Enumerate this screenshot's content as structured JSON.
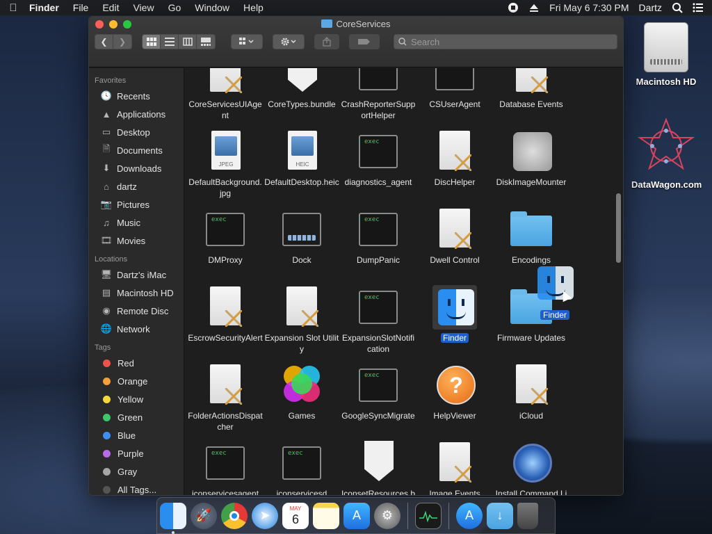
{
  "menubar": {
    "app_name": "Finder",
    "menus": [
      "File",
      "Edit",
      "View",
      "Go",
      "Window",
      "Help"
    ],
    "clock": "Fri May 6  7:30 PM",
    "user": "Dartz"
  },
  "desktop": {
    "items": [
      {
        "label": "Macintosh HD",
        "icon": "hard-drive-icon"
      },
      {
        "label": "DataWagon.com",
        "icon": "datawagon-icon"
      }
    ]
  },
  "window": {
    "title": "CoreServices",
    "search_placeholder": "Search"
  },
  "sidebar": {
    "favorites_header": "Favorites",
    "favorites": [
      {
        "label": "Recents",
        "icon": "recents-icon"
      },
      {
        "label": "Applications",
        "icon": "applications-icon"
      },
      {
        "label": "Desktop",
        "icon": "desktop-icon"
      },
      {
        "label": "Documents",
        "icon": "documents-icon"
      },
      {
        "label": "Downloads",
        "icon": "downloads-icon"
      },
      {
        "label": "dartz",
        "icon": "home-icon"
      },
      {
        "label": "Pictures",
        "icon": "pictures-icon"
      },
      {
        "label": "Music",
        "icon": "music-icon"
      },
      {
        "label": "Movies",
        "icon": "movies-icon"
      }
    ],
    "locations_header": "Locations",
    "locations": [
      {
        "label": "Dartz's iMac",
        "icon": "imac-icon"
      },
      {
        "label": "Macintosh HD",
        "icon": "hard-drive-icon"
      },
      {
        "label": "Remote Disc",
        "icon": "disc-icon"
      },
      {
        "label": "Network",
        "icon": "network-icon"
      }
    ],
    "tags_header": "Tags",
    "tags": [
      {
        "label": "Red",
        "color": "#f0514c"
      },
      {
        "label": "Orange",
        "color": "#f5a03a"
      },
      {
        "label": "Yellow",
        "color": "#f7d73a"
      },
      {
        "label": "Green",
        "color": "#3cc76a"
      },
      {
        "label": "Blue",
        "color": "#3f8ff0"
      },
      {
        "label": "Purple",
        "color": "#b86be6"
      },
      {
        "label": "Gray",
        "color": "#a6a6a6"
      },
      {
        "label": "All Tags...",
        "color": "#555555"
      }
    ]
  },
  "files": [
    {
      "label": "CoreServicesUIAgent",
      "type": "app"
    },
    {
      "label": "CoreTypes.bundle",
      "type": "bundle"
    },
    {
      "label": "CrashReporterSupportHelper",
      "type": "exec"
    },
    {
      "label": "CSUserAgent",
      "type": "exec"
    },
    {
      "label": "Database Events",
      "type": "app"
    },
    {
      "label": "DefaultBackground.jpg",
      "type": "jpeg",
      "ext": "JPEG"
    },
    {
      "label": "DefaultDesktop.heic",
      "type": "jpeg",
      "ext": "HEIC"
    },
    {
      "label": "diagnostics_agent",
      "type": "exec"
    },
    {
      "label": "DiscHelper",
      "type": "app"
    },
    {
      "label": "DiskImageMounter",
      "type": "disk"
    },
    {
      "label": "DMProxy",
      "type": "exec"
    },
    {
      "label": "Dock",
      "type": "dock"
    },
    {
      "label": "DumpPanic",
      "type": "exec"
    },
    {
      "label": "Dwell Control",
      "type": "app"
    },
    {
      "label": "Encodings",
      "type": "folder"
    },
    {
      "label": "EscrowSecurityAlert",
      "type": "app"
    },
    {
      "label": "Expansion Slot Utility",
      "type": "app"
    },
    {
      "label": "ExpansionSlotNotification",
      "type": "exec"
    },
    {
      "label": "Finder",
      "type": "finder",
      "selected": true
    },
    {
      "label": "Firmware Updates",
      "type": "folder"
    },
    {
      "label": "FolderActionsDispatcher",
      "type": "app"
    },
    {
      "label": "Games",
      "type": "games"
    },
    {
      "label": "GoogleSyncMigrate",
      "type": "exec"
    },
    {
      "label": "HelpViewer",
      "type": "help"
    },
    {
      "label": "iCloud",
      "type": "app"
    },
    {
      "label": "iconservicesagent",
      "type": "exec"
    },
    {
      "label": "iconservicesd",
      "type": "exec"
    },
    {
      "label": "IconsetResources.bundle",
      "type": "bundle"
    },
    {
      "label": "Image Events",
      "type": "app"
    },
    {
      "label": "Install Command Line De...per Tools",
      "type": "install"
    }
  ],
  "exec_text": "exec",
  "drag": {
    "label": "Finder"
  },
  "dock": {
    "items": [
      "finder-icon",
      "launchpad-icon",
      "chrome-icon",
      "safari-icon",
      "calendar-icon",
      "notes-icon",
      "app-store-icon",
      "system-preferences-icon",
      "activity-monitor-icon",
      "app-store-folder-icon",
      "downloads-folder-icon",
      "trash-icon"
    ],
    "calendar_month": "MAY",
    "calendar_day": "6"
  }
}
